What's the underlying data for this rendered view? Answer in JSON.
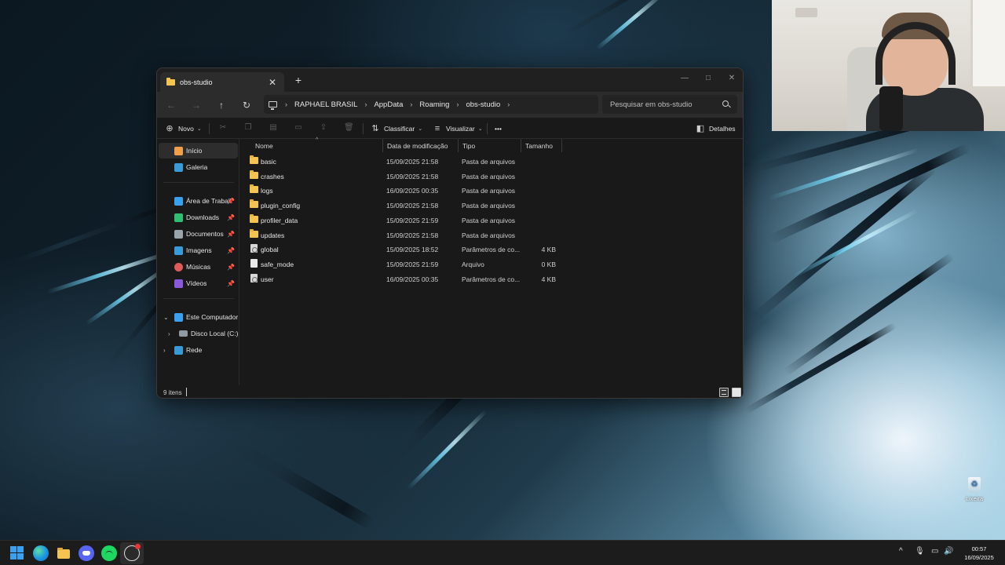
{
  "explorer": {
    "tab_title": "obs-studio",
    "new_tab": "+",
    "window_controls": {
      "minimize": "—",
      "maximize": "□",
      "close": "✕"
    },
    "breadcrumbs": [
      "RAPHAEL BRASIL",
      "AppData",
      "Roaming",
      "obs-studio"
    ],
    "search_placeholder": "Pesquisar em obs-studio",
    "toolbar": {
      "new_label": "Novo",
      "sort_label": "Classificar",
      "view_label": "Visualizar",
      "more_label": "•••",
      "details_label": "Detalhes"
    },
    "sidebar": {
      "quick": [
        {
          "label": "Início",
          "icon": "home-icon",
          "color": "#f0a04b"
        },
        {
          "label": "Galeria",
          "icon": "gallery-icon",
          "color": "#3a9bd9"
        }
      ],
      "pinned": [
        {
          "label": "Área de Trabalho",
          "icon": "desktop-icon",
          "color": "#3aa0f0"
        },
        {
          "label": "Downloads",
          "icon": "download-icon",
          "color": "#2fbf71"
        },
        {
          "label": "Documentos",
          "icon": "document-icon",
          "color": "#9aa4ad"
        },
        {
          "label": "Imagens",
          "icon": "pictures-icon",
          "color": "#3a9bd9"
        },
        {
          "label": "Músicas",
          "icon": "music-icon",
          "color": "#e05a5a"
        },
        {
          "label": "Vídeos",
          "icon": "videos-icon",
          "color": "#8a5ad9"
        }
      ],
      "tree": [
        {
          "label": "Este Computador",
          "icon": "computer-icon",
          "expander": "⌄"
        },
        {
          "label": "Disco Local (C:)",
          "icon": "drive-icon",
          "expander": "›"
        },
        {
          "label": "Rede",
          "icon": "network-icon",
          "expander": "›"
        }
      ]
    },
    "columns": [
      "Nome",
      "Data de modificação",
      "Tipo",
      "Tamanho"
    ],
    "files": [
      {
        "name": "basic",
        "date": "15/09/2025 21:58",
        "type": "Pasta de arquivos",
        "size": "",
        "kind": "folder"
      },
      {
        "name": "crashes",
        "date": "15/09/2025 21:58",
        "type": "Pasta de arquivos",
        "size": "",
        "kind": "folder"
      },
      {
        "name": "logs",
        "date": "16/09/2025 00:35",
        "type": "Pasta de arquivos",
        "size": "",
        "kind": "folder"
      },
      {
        "name": "plugin_config",
        "date": "15/09/2025 21:58",
        "type": "Pasta de arquivos",
        "size": "",
        "kind": "folder"
      },
      {
        "name": "profiler_data",
        "date": "15/09/2025 21:59",
        "type": "Pasta de arquivos",
        "size": "",
        "kind": "folder"
      },
      {
        "name": "updates",
        "date": "15/09/2025 21:58",
        "type": "Pasta de arquivos",
        "size": "",
        "kind": "folder"
      },
      {
        "name": "global",
        "date": "15/09/2025 18:52",
        "type": "Parâmetros de co...",
        "size": "4 KB",
        "kind": "settings"
      },
      {
        "name": "safe_mode",
        "date": "15/09/2025 21:59",
        "type": "Arquivo",
        "size": "0 KB",
        "kind": "file"
      },
      {
        "name": "user",
        "date": "16/09/2025 00:35",
        "type": "Parâmetros de co...",
        "size": "4 KB",
        "kind": "settings"
      }
    ],
    "status": {
      "item_count": "9 itens"
    }
  },
  "desktop": {
    "recycle_bin_label": "Lixeira"
  },
  "taskbar": {
    "apps": [
      "start-button",
      "edge",
      "file-explorer",
      "discord",
      "spotify",
      "obs-studio"
    ],
    "tray": {
      "chevron": "^",
      "mic": "🎙",
      "display": "▭",
      "volume": "🔊"
    },
    "time": "00:57",
    "date": "16/09/2025"
  }
}
